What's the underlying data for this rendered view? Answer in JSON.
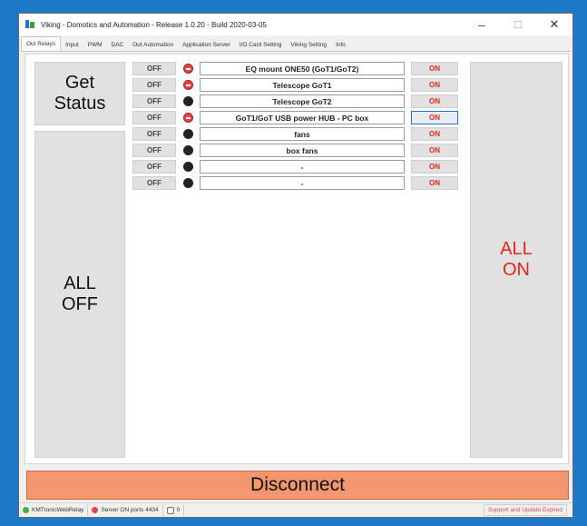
{
  "window": {
    "title": "Viking - Domotics and Automation - Release 1.0.20 - Build 2020-03-05",
    "minimize": "–",
    "maximize": "☐",
    "close": "✕"
  },
  "tabs": [
    {
      "label": "Out Relays",
      "active": true
    },
    {
      "label": "Input"
    },
    {
      "label": "PWM"
    },
    {
      "label": "DAC"
    },
    {
      "label": "Out Automation"
    },
    {
      "label": "Application Server"
    },
    {
      "label": "I/O Card Setting"
    },
    {
      "label": "Viking Setting"
    },
    {
      "label": "Info"
    }
  ],
  "buttons": {
    "get_status": "Get\nStatus",
    "all_off": "ALL\nOFF",
    "all_on": "ALL\nON",
    "disconnect": "Disconnect"
  },
  "relays": [
    {
      "off": "OFF",
      "name": "EQ mount ONE50 (GoT1/GoT2)",
      "on": "ON",
      "led": "on"
    },
    {
      "off": "OFF",
      "name": "Telescope GoT1",
      "on": "ON",
      "led": "on"
    },
    {
      "off": "OFF",
      "name": "Telescope GoT2",
      "on": "ON",
      "led": "off"
    },
    {
      "off": "OFF",
      "name": "GoT1/GoT USB power HUB - PC box",
      "on": "ON",
      "led": "on"
    },
    {
      "off": "OFF",
      "name": "fans",
      "on": "ON",
      "led": "off"
    },
    {
      "off": "OFF",
      "name": "box fans",
      "on": "ON",
      "led": "off"
    },
    {
      "off": "OFF",
      "name": "-",
      "on": "ON",
      "led": "off"
    },
    {
      "off": "OFF",
      "name": "-",
      "on": "ON",
      "led": "off"
    }
  ],
  "statusbar": {
    "device": "KMTronicWebRelay",
    "server": "Server ON ports 4434",
    "counter": "0",
    "support": "Support and Update Expired"
  },
  "colors": {
    "accent_red": "#e0281e",
    "disconnect_bg": "#f4966e",
    "led_on": "#e04848",
    "led_off": "#222222"
  }
}
